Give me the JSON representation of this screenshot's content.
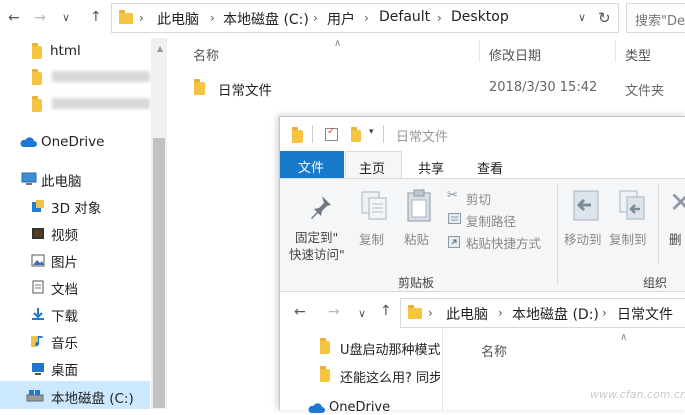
{
  "back_window": {
    "address": {
      "crumbs": [
        "此电脑",
        "本地磁盘 (C:)",
        "用户",
        "Default",
        "Desktop"
      ],
      "search_placeholder": "搜索\"De"
    },
    "sidebar": {
      "quick_items": [
        "html"
      ],
      "onedrive": "OneDrive",
      "this_pc": "此电脑",
      "pc_items": [
        "3D 对象",
        "视频",
        "图片",
        "文档",
        "下载",
        "音乐",
        "桌面",
        "本地磁盘 (C:)"
      ]
    },
    "columns": {
      "name": "名称",
      "date": "修改日期",
      "type": "类型"
    },
    "files": [
      {
        "name": "日常文件",
        "date": "2018/3/30 15:42",
        "type": "文件夹"
      }
    ]
  },
  "front_window": {
    "title": "日常文件",
    "tabs": {
      "file": "文件",
      "home": "主页",
      "share": "共享",
      "view": "查看"
    },
    "clipboard": {
      "pin": "固定到\"\n快速访问\"",
      "pin_line1": "固定到\"",
      "pin_line2": "快速访问\"",
      "copy": "复制",
      "paste": "粘贴",
      "cut": "剪切",
      "copy_path": "复制路径",
      "paste_shortcut": "粘贴快捷方式",
      "group": "剪贴板"
    },
    "organize": {
      "move_to": "移动到",
      "copy_to": "复制到",
      "delete": "删",
      "group": "组织"
    },
    "address": {
      "crumbs": [
        "此电脑",
        "本地磁盘 (D:)",
        "日常文件"
      ]
    },
    "nav_items": [
      "U盘启动那种模式",
      "还能这么用? 同步",
      "OneDrive"
    ],
    "columns": {
      "name": "名称"
    }
  },
  "watermark": "www.cfan.com.cn"
}
